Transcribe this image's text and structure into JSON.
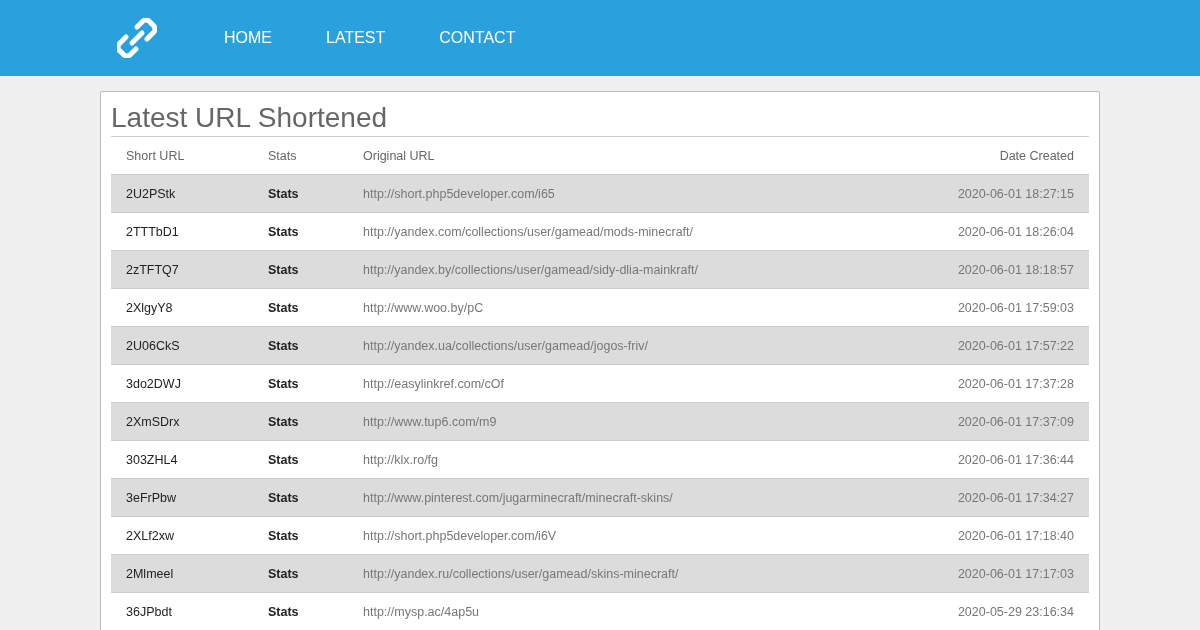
{
  "nav": {
    "items": [
      {
        "label": "HOME"
      },
      {
        "label": "LATEST"
      },
      {
        "label": "CONTACT"
      }
    ]
  },
  "title": "Latest URL Shortened",
  "table": {
    "columns": [
      "Short URL",
      "Stats",
      "Original URL",
      "Date Created"
    ],
    "rows": [
      {
        "short": "2U2PStk",
        "stats": "Stats",
        "url": "http://short.php5developer.com/i65",
        "date": "2020-06-01 18:27:15"
      },
      {
        "short": "2TTTbD1",
        "stats": "Stats",
        "url": "http://yandex.com/collections/user/gamead/mods-minecraft/",
        "date": "2020-06-01 18:26:04"
      },
      {
        "short": "2zTFTQ7",
        "stats": "Stats",
        "url": "http://yandex.by/collections/user/gamead/sidy-dlia-mainkraft/",
        "date": "2020-06-01 18:18:57"
      },
      {
        "short": "2XlgyY8",
        "stats": "Stats",
        "url": "http://www.woo.by/pC",
        "date": "2020-06-01 17:59:03"
      },
      {
        "short": "2U06CkS",
        "stats": "Stats",
        "url": "http://yandex.ua/collections/user/gamead/jogos-friv/",
        "date": "2020-06-01 17:57:22"
      },
      {
        "short": "3do2DWJ",
        "stats": "Stats",
        "url": "http://easylinkref.com/cOf",
        "date": "2020-06-01 17:37:28"
      },
      {
        "short": "2XmSDrx",
        "stats": "Stats",
        "url": "http://www.tup6.com/m9",
        "date": "2020-06-01 17:37:09"
      },
      {
        "short": "303ZHL4",
        "stats": "Stats",
        "url": "http://klx.ro/fg",
        "date": "2020-06-01 17:36:44"
      },
      {
        "short": "3eFrPbw",
        "stats": "Stats",
        "url": "http://www.pinterest.com/jugarminecraft/minecraft-skins/",
        "date": "2020-06-01 17:34:27"
      },
      {
        "short": "2XLf2xw",
        "stats": "Stats",
        "url": "http://short.php5developer.com/i6V",
        "date": "2020-06-01 17:18:40"
      },
      {
        "short": "2Mlmeel",
        "stats": "Stats",
        "url": "http://yandex.ru/collections/user/gamead/skins-minecraft/",
        "date": "2020-06-01 17:17:03"
      },
      {
        "short": "36JPbdt",
        "stats": "Stats",
        "url": "http://mysp.ac/4ap5u",
        "date": "2020-05-29 23:16:34"
      }
    ]
  }
}
